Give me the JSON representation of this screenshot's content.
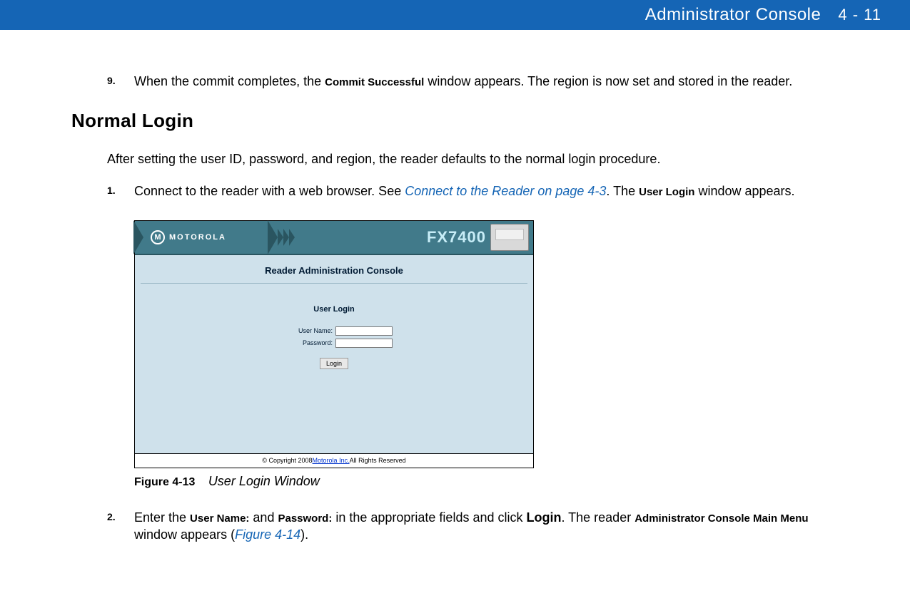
{
  "header": {
    "title": "Administrator Console",
    "page_num": "4 - 11"
  },
  "step9": {
    "num": "9.",
    "text_pre": "When the commit completes, the ",
    "term1": "Commit Successful",
    "text_post": " window appears. The region is now set and stored in the reader."
  },
  "section": {
    "heading": "Normal Login",
    "intro": "After setting the user ID, password, and region, the reader defaults to the normal login procedure."
  },
  "step1": {
    "num": "1.",
    "text_pre": "Connect to the reader with a web browser. See ",
    "link": "Connect to the Reader on page 4-3",
    "text_mid": ". The ",
    "term1": "User Login",
    "text_post": " window appears."
  },
  "screenshot": {
    "logo_text": "MOTOROLA",
    "logo_letter": "M",
    "product": "FX7400",
    "console_title": "Reader Administration Console",
    "login_title": "User Login",
    "username_label": "User Name:",
    "password_label": "Password:",
    "login_button": "Login",
    "footer_pre": "© Copyright 2008 ",
    "footer_link": "Motorola Inc.",
    "footer_post": " All Rights Reserved"
  },
  "figure": {
    "label": "Figure 4-13",
    "title": "User Login Window"
  },
  "step2": {
    "num": "2.",
    "text_pre": "Enter the ",
    "term1": "User Name:",
    "text_mid1": " and ",
    "term2": "Password:",
    "text_mid2": " in the appropriate fields and click ",
    "bold1": "Login",
    "text_mid3": ". The reader ",
    "term3": "Administrator Console Main Menu",
    "text_mid4": " window appears (",
    "link": "Figure 4-14",
    "text_post": ")."
  }
}
